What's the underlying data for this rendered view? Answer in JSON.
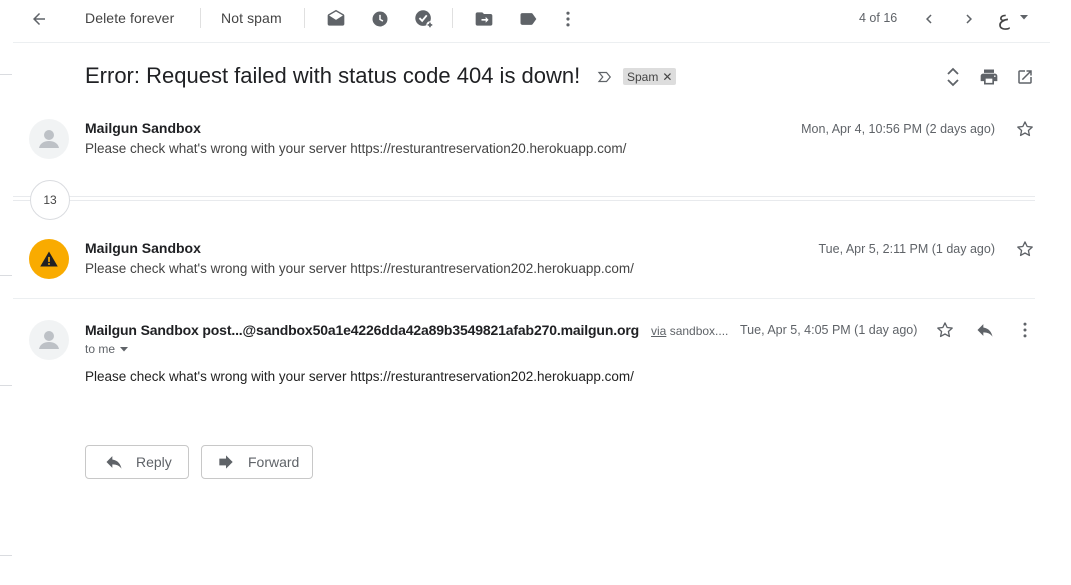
{
  "toolbar": {
    "delete_forever": "Delete forever",
    "not_spam": "Not spam",
    "pagination": "4 of 16",
    "input_tool": "ع",
    "icons": [
      "back-arrow-icon",
      "mark-unread-icon",
      "snooze-clock-icon",
      "add-task-icon",
      "move-to-icon",
      "label-icon",
      "more-vert-icon",
      "chevron-left-icon",
      "chevron-right-icon",
      "dropdown-caret-icon"
    ]
  },
  "thread": {
    "subject": "Error: Request failed with status code 404 is down!",
    "label_chip": "Spam",
    "collapsed_count": "13"
  },
  "messages": [
    {
      "sender": "Mailgun Sandbox",
      "snippet": "Please check what's wrong with your server https://resturantreservation20.herokuapp.com/",
      "date": "Mon, Apr 4, 10:56 PM (2 days ago)"
    },
    {
      "sender": "Mailgun Sandbox",
      "snippet": "Please check what's wrong with your server https://resturantreservation202.herokuapp.com/",
      "date": "Tue, Apr 5, 2:11 PM (1 day ago)"
    },
    {
      "sender": "Mailgun Sandbox post...@sandbox50a1e4226dda42a89b3549821afab270.mailgun.org",
      "via_label": "via",
      "via_domain": "sandbox....",
      "recipient": "to me",
      "date": "Tue, Apr 5, 4:05 PM (1 day ago)",
      "body": "Please check what's wrong with your server https://resturantreservation202.herokuapp.com/"
    }
  ],
  "actions": {
    "reply": "Reply",
    "forward": "Forward"
  },
  "colors": {
    "warning_avatar": "#f9ab00",
    "icon_gray": "#5f6368",
    "divider": "#eceff1"
  }
}
